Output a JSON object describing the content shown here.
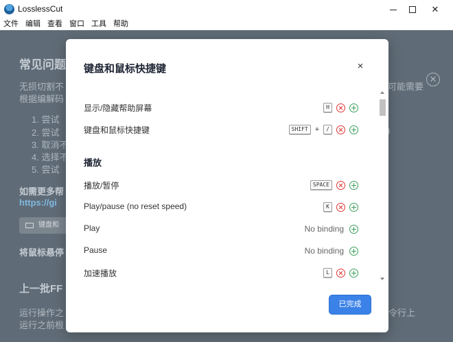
{
  "window": {
    "title": "LosslessCut",
    "minimize": "—",
    "close": "✕"
  },
  "menu": [
    "文件",
    "编辑",
    "查看",
    "窗口",
    "工具",
    "帮助"
  ],
  "background": {
    "heading": "常见问题",
    "line1": "无损切割不",
    "line1_right": "可能需要",
    "line2": "根据编解码",
    "list": [
      "1. 尝试",
      "2. 尝试",
      "3. 取消不",
      "4. 选择不",
      "5. 尝试"
    ],
    "list_right": ")",
    "more_help": "如需更多帮",
    "link": "https://gi",
    "kbd_button": "键盘和",
    "hover_hint": "将鼠标悬停",
    "section2": "上一批FF",
    "para1": "运行操作之",
    "para1_right": "令行上",
    "para2": "运行之前根"
  },
  "modal": {
    "title": "键盘和鼠标快捷键",
    "close": "×",
    "done": "已完成",
    "rows_top": [
      {
        "label": "显示/隐藏帮助屏幕",
        "keys": [
          "H"
        ]
      },
      {
        "label": "键盘和鼠标快捷键",
        "keys": [
          "SHIFT",
          "/"
        ]
      }
    ],
    "plus": "+",
    "section": "播放",
    "rows_playback": [
      {
        "label": "播放/暂停",
        "keys": [
          "SPACE"
        ]
      },
      {
        "label": "Play/pause (no reset speed)",
        "keys": [
          "K"
        ]
      },
      {
        "label": "Play",
        "no_binding": "No binding"
      },
      {
        "label": "Pause",
        "no_binding": "No binding"
      },
      {
        "label": "加速播放",
        "keys": [
          "L"
        ]
      }
    ]
  }
}
